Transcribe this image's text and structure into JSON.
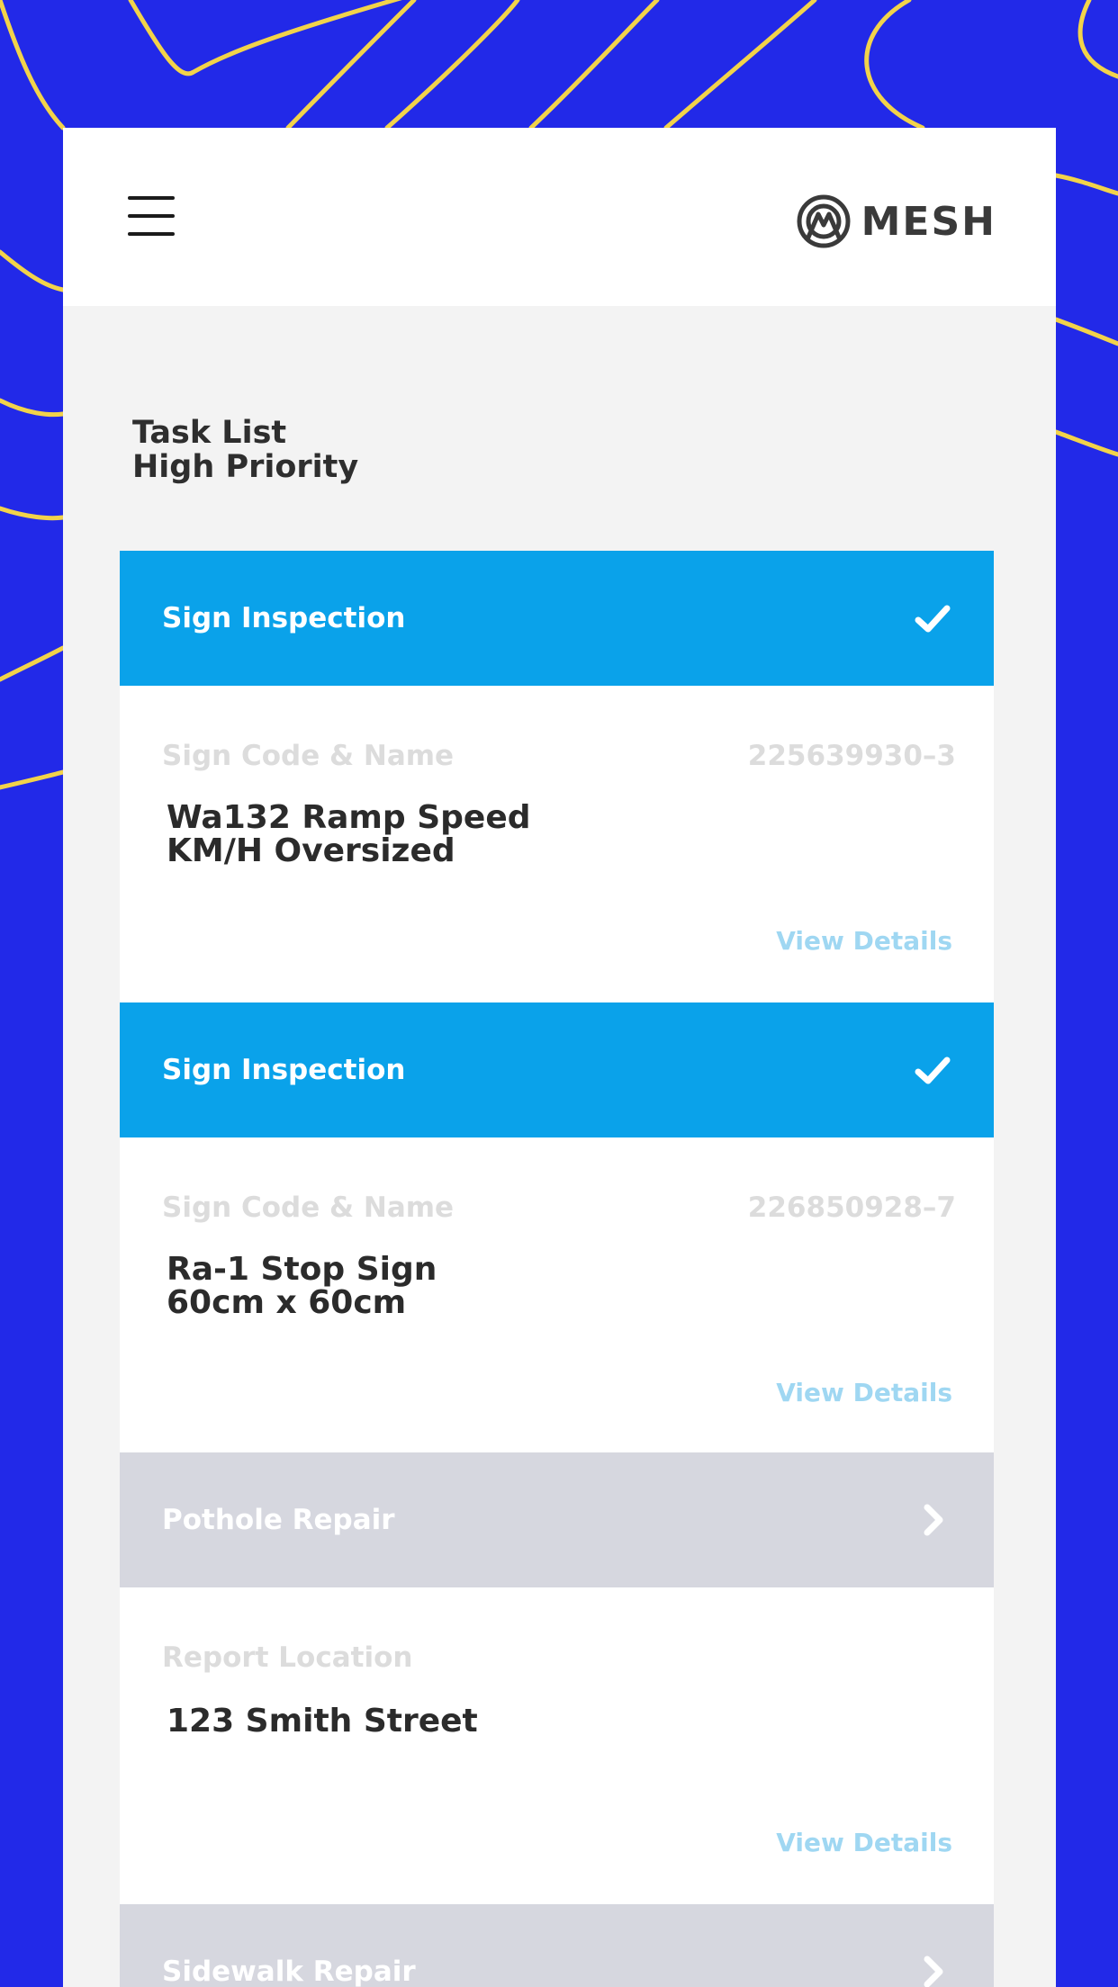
{
  "header": {
    "logo_text": "MESH"
  },
  "page": {
    "title_line1": "Task List",
    "title_line2": "High Priority"
  },
  "tasks": [
    {
      "title": "Sign Inspection",
      "status": "done",
      "icon": "check-icon",
      "field_label": "Sign Code & Name",
      "code": "225639930–3",
      "value_line1": "Wa132 Ramp Speed",
      "value_line2": "KM/H Oversized",
      "link": "View Details"
    },
    {
      "title": "Sign Inspection",
      "status": "done",
      "icon": "check-icon",
      "field_label": "Sign Code & Name",
      "code": "226850928–7",
      "value_line1": "Ra-1 Stop Sign",
      "value_line2": "60cm x 60cm",
      "link": "View Details"
    },
    {
      "title": "Pothole Repair",
      "status": "pending",
      "icon": "chevron-right-icon",
      "field_label": "Report Location",
      "value_line1": "123 Smith Street",
      "link": "View Details"
    },
    {
      "title": "Sidewalk Repair",
      "status": "pending",
      "icon": "chevron-right-icon"
    }
  ],
  "colors": {
    "background": "#2229e8",
    "lines": "#f2d34a",
    "active": "#0aa2ea",
    "inactive": "#d6d7df",
    "link": "#9fd7f2"
  }
}
